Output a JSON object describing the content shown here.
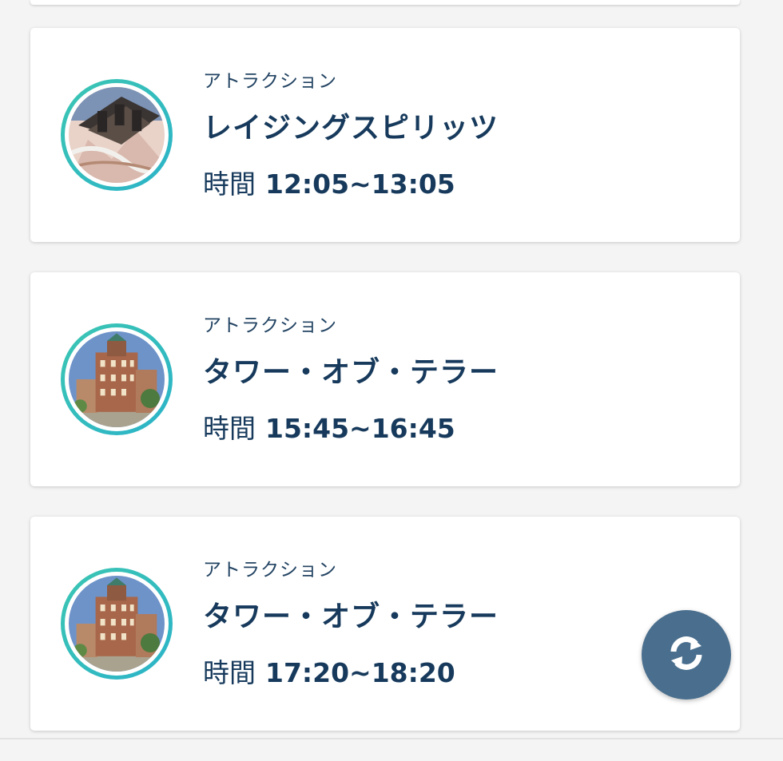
{
  "cards": [
    {
      "category": "アトラクション",
      "title": "レイジングスピリッツ",
      "time_label": "時間",
      "time_value": "12:05~13:05",
      "image": "coaster-photo"
    },
    {
      "category": "アトラクション",
      "title": "タワー・オブ・テラー",
      "time_label": "時間",
      "time_value": "15:45~16:45",
      "image": "tower-photo"
    },
    {
      "category": "アトラクション",
      "title": "タワー・オブ・テラー",
      "time_label": "時間",
      "time_value": "17:20~18:20",
      "image": "tower-photo"
    }
  ],
  "fab": {
    "icon": "refresh-icon",
    "color": "#4a6f8e"
  },
  "colors": {
    "text": "#173a5c",
    "ring": "#3cc6b2"
  }
}
